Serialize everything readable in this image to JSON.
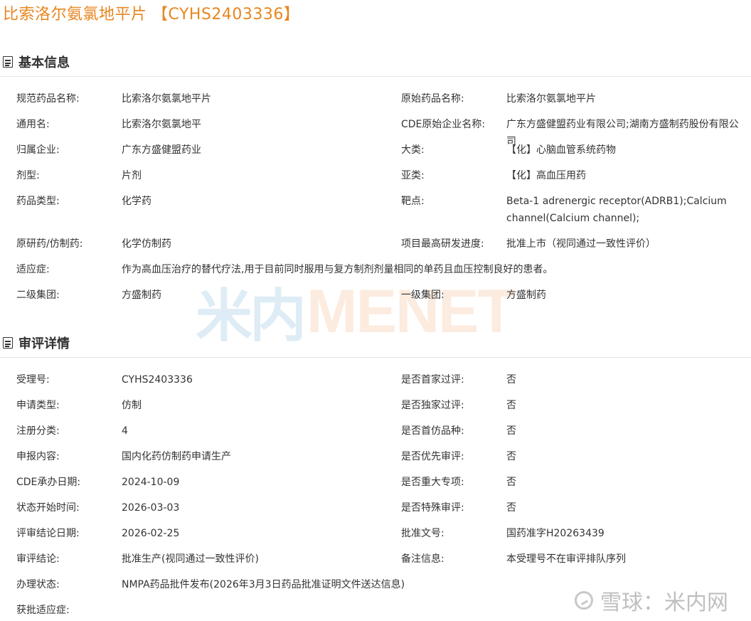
{
  "page": {
    "title": "比索洛尔氨氯地平片 【CYHS2403336】"
  },
  "basic_info": {
    "heading": "基本信息",
    "rows": [
      {
        "l1": "规范药品名称:",
        "v1": "比索洛尔氨氯地平片",
        "l2": "原始药品名称:",
        "v2": "比索洛尔氨氯地平片"
      },
      {
        "l1": "通用名:",
        "v1": "比索洛尔氨氯地平",
        "l2": "CDE原始企业名称:",
        "v2": "广东方盛健盟药业有限公司;湖南方盛制药股份有限公司"
      },
      {
        "l1": "归属企业:",
        "v1": "广东方盛健盟药业",
        "l2": "大类:",
        "v2": "【化】心脑血管系统药物"
      },
      {
        "l1": "剂型:",
        "v1": "片剂",
        "l2": "亚类:",
        "v2": "【化】高血压用药"
      },
      {
        "l1": "药品类型:",
        "v1": "化学药",
        "l2": "靶点:",
        "v2": "Beta-1 adrenergic receptor(ADRB1);Calcium channel(Calcium channel);"
      },
      {
        "l1": "原研药/仿制药:",
        "v1": "化学仿制药",
        "l2": "项目最高研发进度:",
        "v2": "批准上市（视同通过一致性评价）"
      },
      {
        "l1": "适应症:",
        "v1": "作为高血压治疗的替代疗法,用于目前同时服用与复方制剂剂量相同的单药且血压控制良好的患者。"
      },
      {
        "l1": "二级集团:",
        "v1": "方盛制药",
        "l2": "一级集团:",
        "v2": "方盛制药"
      }
    ]
  },
  "review_details": {
    "heading": "审评详情",
    "rows": [
      {
        "l1": "受理号:",
        "v1": "CYHS2403336",
        "l2": "是否首家过评:",
        "v2": "否"
      },
      {
        "l1": "申请类型:",
        "v1": "仿制",
        "l2": "是否独家过评:",
        "v2": "否"
      },
      {
        "l1": "注册分类:",
        "v1": "4",
        "l2": "是否首仿品种:",
        "v2": "否"
      },
      {
        "l1": "申报内容:",
        "v1": "国内化药仿制药申请生产",
        "l2": "是否优先审评:",
        "v2": "否"
      },
      {
        "l1": "CDE承办日期:",
        "v1": "2024-10-09",
        "l2": "是否重大专项:",
        "v2": "否"
      },
      {
        "l1": "状态开始时间:",
        "v1": "2026-03-03",
        "l2": "是否特殊审评:",
        "v2": "否"
      },
      {
        "l1": "评审结论日期:",
        "v1": "2026-02-25",
        "l2": "批准文号:",
        "v2": "国药准字H20263439"
      },
      {
        "l1": "审评结论:",
        "v1": "批准生产(视同通过一致性评价)",
        "l2": "备注信息:",
        "v2": "本受理号不在审评排队序列"
      },
      {
        "l1": "办理状态:",
        "v1": "NMPA药品批件发布(2026年3月3日药品批准证明文件送达信息)"
      },
      {
        "l1": "获批适应症:"
      }
    ]
  },
  "watermarks": {
    "center_cn": "米内",
    "center_en": "MENET",
    "corner_text": "雪球：米内网"
  }
}
